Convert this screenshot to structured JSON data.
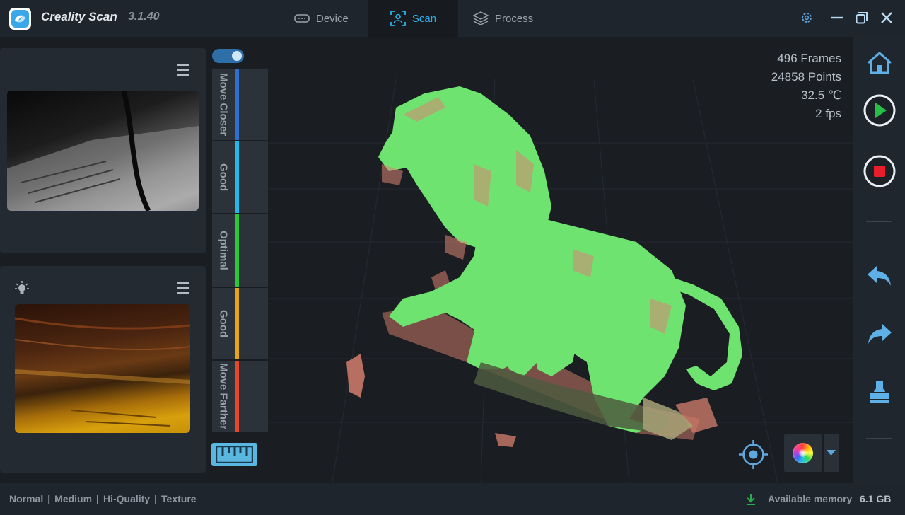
{
  "app": {
    "title": "Creality Scan",
    "version": "3.1.40"
  },
  "tabs": [
    {
      "label": "Device",
      "icon": "device-icon",
      "active": false
    },
    {
      "label": "Scan",
      "icon": "scan-icon",
      "active": true
    },
    {
      "label": "Process",
      "icon": "layers-icon",
      "active": false
    }
  ],
  "window_controls": [
    "settings-icon",
    "minimize-icon",
    "restore-icon",
    "close-icon"
  ],
  "stats": {
    "frames": "496 Frames",
    "points": "24858 Points",
    "temperature": "32.5 ℃",
    "fps": "2 fps"
  },
  "distance_indicator": {
    "toggle_on": true,
    "segments": [
      {
        "label": "Move Closer",
        "color": "#2f6fd0"
      },
      {
        "label": "Good",
        "color": "#22b8e8"
      },
      {
        "label": "Optimal",
        "color": "#28c83a"
      },
      {
        "label": "Good",
        "color": "#e8a419"
      },
      {
        "label": "Move Farther",
        "color": "#e4472a"
      }
    ]
  },
  "side_toolbar": [
    "home-icon",
    "play-icon",
    "stop-icon",
    "undo-icon",
    "redo-icon",
    "stamp-icon"
  ],
  "status": {
    "modes": [
      "Normal",
      "Medium",
      "Hi-Quality",
      "Texture"
    ],
    "memory_label": "Available memory",
    "memory_value": "6.1 GB"
  },
  "colors": {
    "accent": "#2ab0e8",
    "model_green": "#6fe36f",
    "model_red": "#d98574"
  }
}
